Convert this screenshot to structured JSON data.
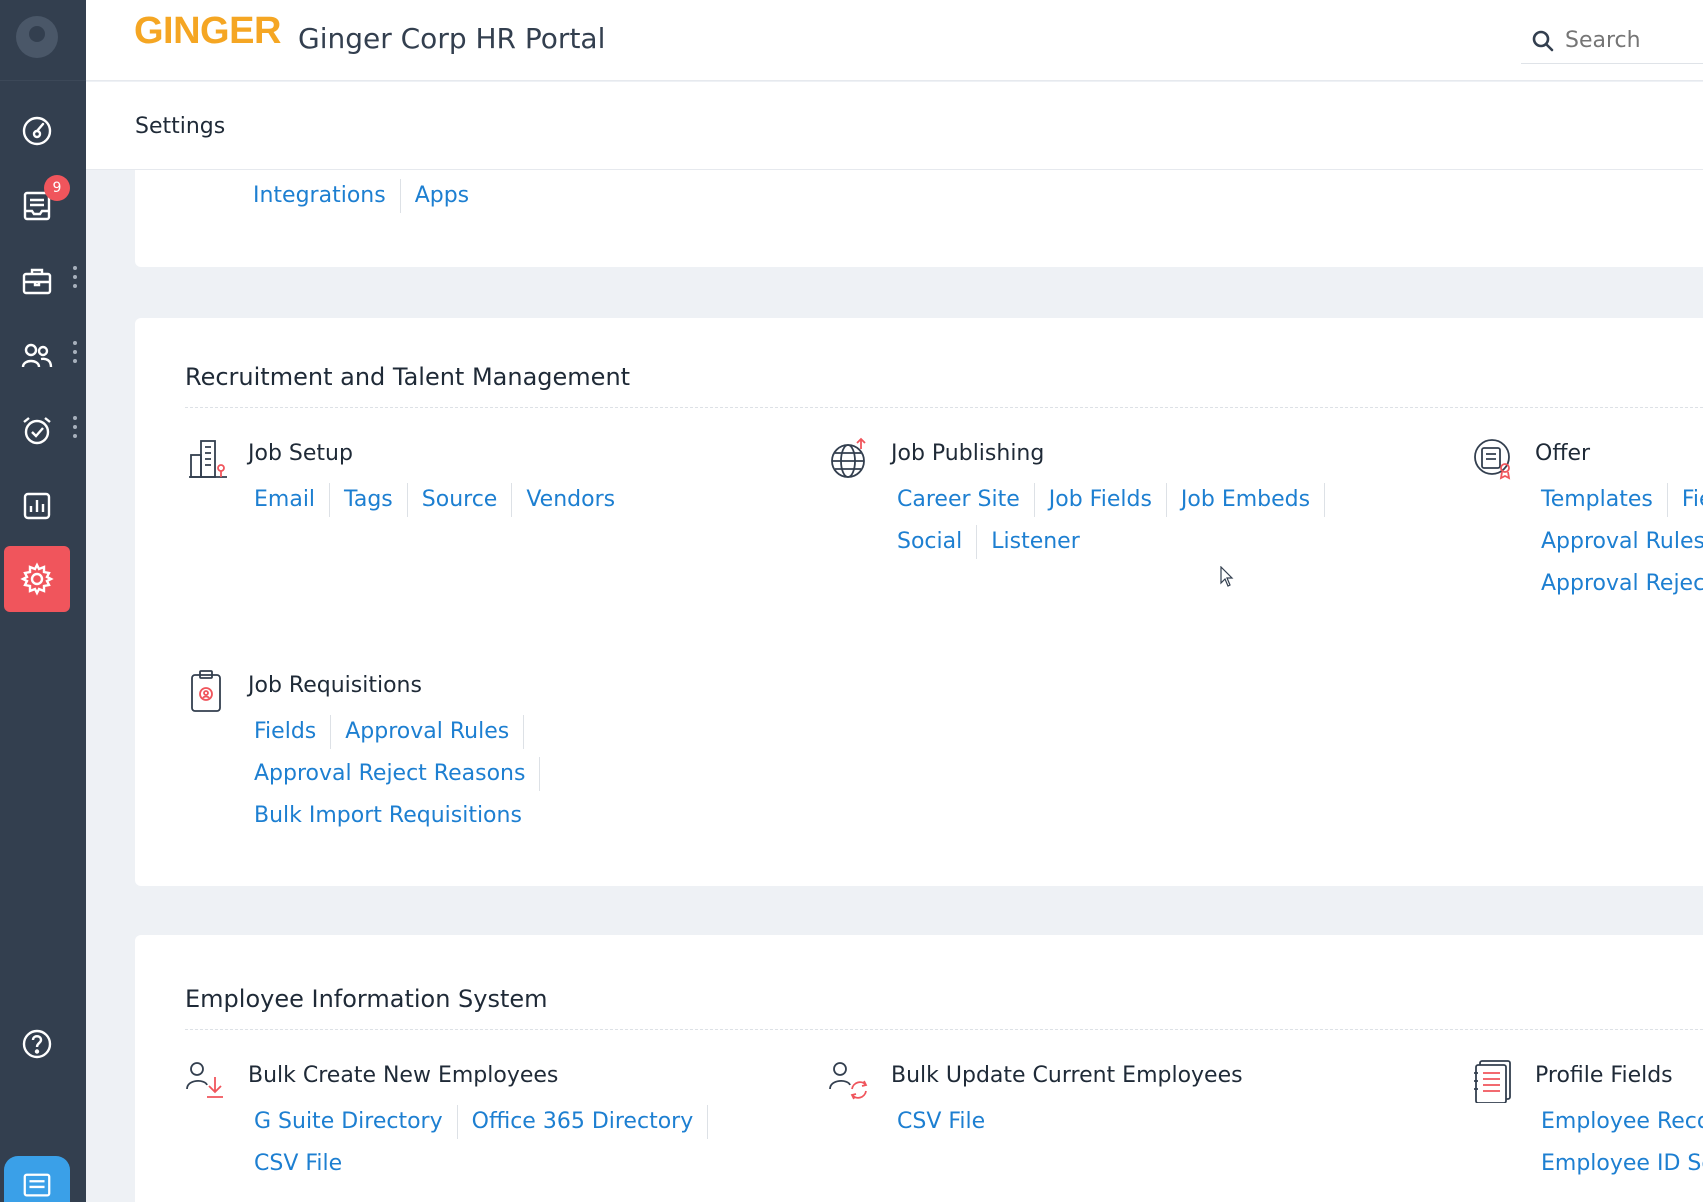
{
  "app": {
    "logo_text": "GINGER",
    "title": "Ginger Corp HR Portal",
    "search_placeholder": "Search"
  },
  "page": {
    "title": "Settings"
  },
  "sidebar": {
    "notification_count": "9",
    "items": [
      {
        "icon": "dashboard-icon"
      },
      {
        "icon": "inbox-icon"
      },
      {
        "icon": "briefcase-icon"
      },
      {
        "icon": "people-icon"
      },
      {
        "icon": "alarm-clock-icon"
      },
      {
        "icon": "reports-chart-icon"
      },
      {
        "icon": "gear-icon",
        "active": true
      }
    ],
    "bottom": [
      {
        "icon": "help-icon"
      },
      {
        "icon": "chat-icon"
      }
    ]
  },
  "integrations_card": {
    "links": [
      "Integrations",
      "Apps"
    ]
  },
  "recruitment": {
    "title": "Recruitment and Talent Management",
    "job_setup": {
      "title": "Job Setup",
      "links": [
        "Email",
        "Tags",
        "Source",
        "Vendors"
      ]
    },
    "job_publishing": {
      "title": "Job Publishing",
      "links_row1": [
        "Career Site",
        "Job Fields",
        "Job Embeds"
      ],
      "links_row2": [
        "Social",
        "Listener"
      ]
    },
    "offer": {
      "title": "Offer",
      "links_row1": [
        "Templates",
        "Fiel"
      ],
      "links_row2": [
        "Approval Rules"
      ],
      "links_row3": [
        "Approval Reject"
      ]
    },
    "job_requisitions": {
      "title": "Job Requisitions",
      "links_row1": [
        "Fields",
        "Approval Rules"
      ],
      "links_row2": [
        "Approval Reject Reasons"
      ],
      "links_row3": [
        "Bulk Import Requisitions"
      ]
    }
  },
  "employee_info": {
    "title": "Employee Information System",
    "bulk_create": {
      "title": "Bulk Create New Employees",
      "links_row1": [
        "G Suite Directory",
        "Office 365 Directory"
      ],
      "links_row2": [
        "CSV File"
      ]
    },
    "bulk_update": {
      "title": "Bulk Update Current Employees",
      "links": [
        "CSV File"
      ]
    },
    "profile_fields": {
      "title": "Profile Fields",
      "links_row1": [
        "Employee Recor"
      ],
      "links_row2": [
        "Employee ID Sec"
      ]
    }
  },
  "colors": {
    "sidebar_bg": "#333f4f",
    "accent_red": "#f0555c",
    "link_blue": "#1d7fd1",
    "logo_orange": "#f5a623"
  }
}
